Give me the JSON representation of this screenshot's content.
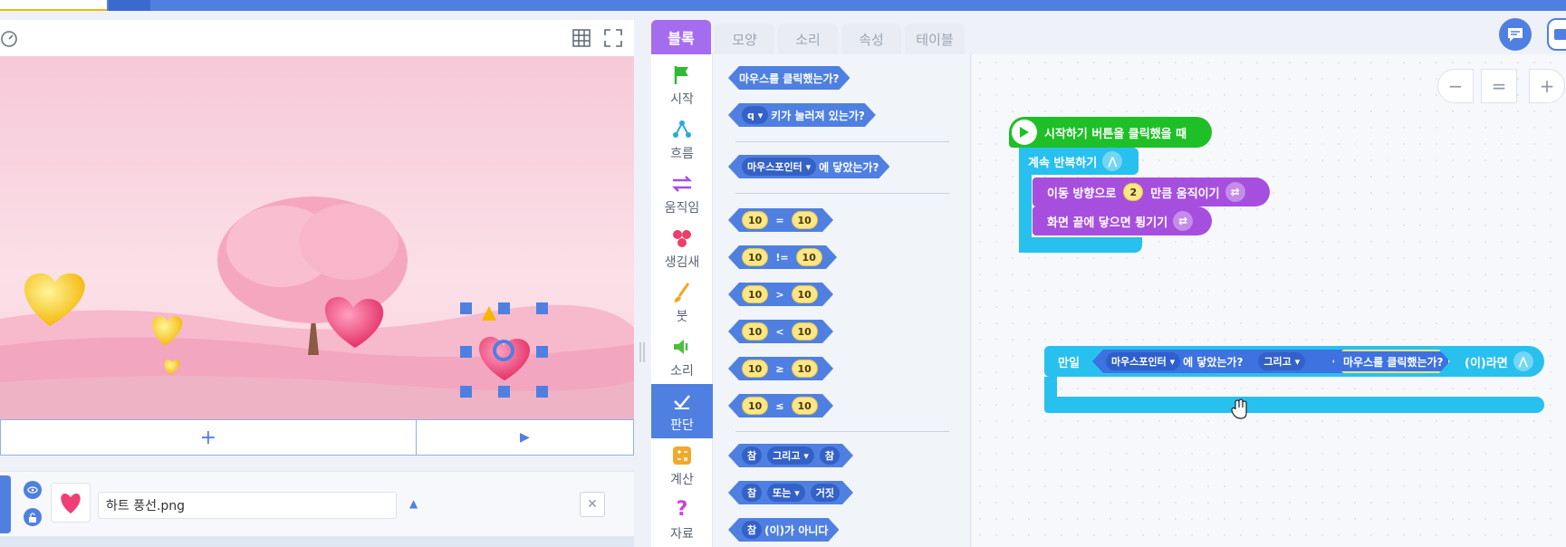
{
  "colors": {
    "topbar": "#4f80e1",
    "block_blue": "#4f80e1",
    "judge_blue": "#3d72e0",
    "start_green": "#1fbf27",
    "flow_cyan": "#28c0ee",
    "move_purple": "#a64fdf",
    "tab_active": "#a66cf0"
  },
  "stage": {
    "speed_icon": "speedometer-icon",
    "grid_icon": "grid-icon",
    "fullscreen_icon": "fullscreen-icon",
    "add_label": "+",
    "play_label": "▶"
  },
  "object": {
    "name_value": "하트 풍선.png",
    "visible_icon": "eye-icon",
    "lock_icon": "lock-icon",
    "close_label": "✕",
    "expand_label": "▲"
  },
  "tabs": [
    "블록",
    "모양",
    "소리",
    "속성",
    "테이블"
  ],
  "categories": [
    {
      "label": "시작",
      "icon": "flag-icon",
      "color": "#2dbb34"
    },
    {
      "label": "흐름",
      "icon": "flow-icon",
      "color": "#28a9e0"
    },
    {
      "label": "움직임",
      "icon": "move-arrows-icon",
      "color": "#a64fdf"
    },
    {
      "label": "생김새",
      "icon": "looks-icon",
      "color": "#ec3f6a"
    },
    {
      "label": "붓",
      "icon": "brush-icon",
      "color": "#f5a623"
    },
    {
      "label": "소리",
      "icon": "speaker-icon",
      "color": "#4cbf3f"
    },
    {
      "label": "판단",
      "icon": "check-icon",
      "color": "#ffffff"
    },
    {
      "label": "계산",
      "icon": "calculator-icon",
      "color": "#f0a92a"
    },
    {
      "label": "자료",
      "icon": "question-icon",
      "color": "#c844d8"
    }
  ],
  "palette": {
    "mouse_clicked": "마우스를 클릭했는가?",
    "key_value": "q",
    "key_pressed": "키가 눌러져 있는가?",
    "touch_target": "마우스포인터",
    "touched": "에 닿았는가?",
    "num": "10",
    "ops": [
      "=",
      "!=",
      ">",
      "<",
      "≥",
      "≤"
    ],
    "true_label": "참",
    "false_label": "거짓",
    "and_label": "그리고",
    "or_label": "또는",
    "not_label": "(이)가 아니다"
  },
  "script": {
    "start": "시작하기 버튼을 클릭했을 때",
    "forever": "계속 반복하기",
    "move_prefix": "이동 방향으로",
    "move_value": "2",
    "move_suffix": "만큼 움직이기",
    "bounce": "화면 끝에 닿으면 튕기기",
    "if_label": "만일",
    "if_touch_target": "마우스포인터",
    "if_touched": "에 닿았는가?",
    "if_and": "그리고",
    "if_clicked": "마우스를 클릭했는가?",
    "if_then": "(이)라면"
  },
  "zoom": {
    "minus": "−",
    "reset": "=",
    "plus": "+"
  }
}
